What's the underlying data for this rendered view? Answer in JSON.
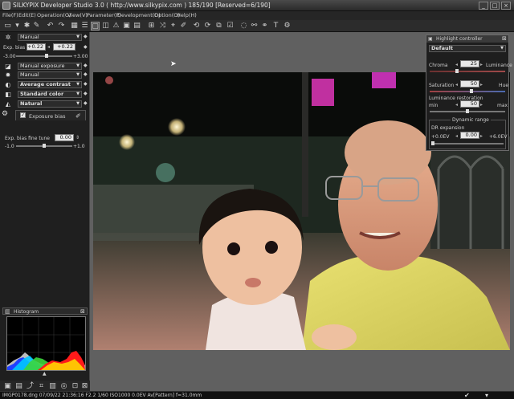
{
  "titlebar": {
    "title": "SILKYPIX Developer Studio 3.0 ( http://www.silkypix.com )  185/190 [Reserved=6/190]",
    "minimize": "_",
    "maximize": "□",
    "close": "×"
  },
  "menu": [
    "File(F)",
    "Edit(E)",
    "Operation(O)",
    "View(V)",
    "Parameter(P)",
    "Development(D)",
    "Option(O)",
    "Help(H)"
  ],
  "left_panel": {
    "white_balance": {
      "value": "Manual"
    },
    "exp_bias": {
      "label": "Exp. bias",
      "value_a": "+0.22",
      "value_b": "+0.22",
      "range_min": "-3.00",
      "range_max": "+3.00",
      "level_fraction": 0.54
    },
    "exposure_dropdown": "Manual exposure",
    "tone_dropdown": "Manual",
    "contrast_dropdown": "Average contrast",
    "color_dropdown": "Standard color",
    "sharpness_dropdown": "Natural",
    "exposure_bias_tab": {
      "label": "Exposure bias",
      "checked": true
    },
    "fine_tune": {
      "label": "Exp. bias fine tune",
      "value": "0.00",
      "range_min": "-1.0",
      "range_max": "+1.0",
      "level_fraction": 0.5
    },
    "histogram_title": "Histogram"
  },
  "highlight_controller": {
    "title": "Highlight controller",
    "preset": "Default",
    "chroma": {
      "label_left": "Chroma",
      "label_right": "Luminance",
      "value": "25",
      "level_fraction": 0.35
    },
    "saturation": {
      "label_left": "Saturation",
      "label_right": "Hue",
      "value": "50",
      "level_fraction": 0.55
    },
    "luminance_restoration": {
      "label": "Luminance restoration",
      "min_label": "min",
      "max_label": "max",
      "value": "50",
      "level_fraction": 0.5
    },
    "dynamic_range": {
      "group_label": "Dynamic range",
      "label": "DR expansion",
      "min_label": "+0.0EV",
      "max_label": "+6.0EV",
      "value": "0.00",
      "level_fraction": 0.0
    }
  },
  "statusbar": {
    "text": "IMGP0178.dng 07/09/22 21:36:16 F2.2 1/60 ISO1000 0.0EV Av[Pattern] f=31.0mm"
  },
  "icons": {
    "toolbar": [
      "folder-icon",
      "save-icon",
      "gear-icon",
      "undo-icon",
      "redo-icon",
      "view-single-icon",
      "view-grid-icon",
      "view-filmstrip-icon",
      "view-compare-icon",
      "warning-icon",
      "fullscreen-icon",
      "grid-icon",
      "tone-curve-icon",
      "color-picker-icon",
      "crop-icon",
      "rotate-left-icon",
      "rotate-right-icon",
      "copy-icon",
      "paste-icon",
      "check-icon",
      "spot-icon",
      "print-icon",
      "mask-icon",
      "text-icon",
      "help-icon"
    ]
  },
  "colors": {
    "panel_bg": "#1f1f1f",
    "viewer_bg": "#606060",
    "chroma_track": "#b04040",
    "hue_track": "#4070c0"
  }
}
